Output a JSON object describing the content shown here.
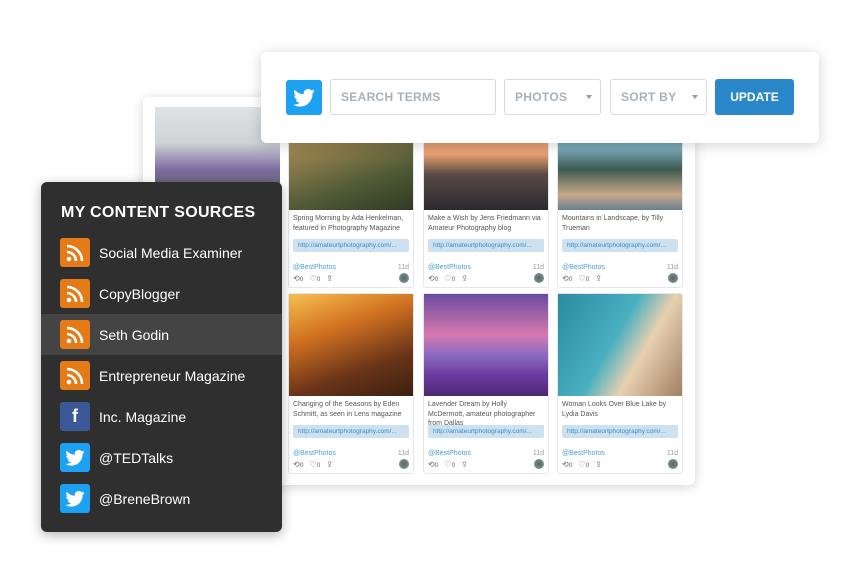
{
  "search": {
    "placeholder": "SEARCH TERMS",
    "photos": "PHOTOS",
    "sort": "SORT BY",
    "update": "UPDATE"
  },
  "sidebar": {
    "title": "MY CONTENT SOURCES",
    "items": [
      {
        "label": "Social Media Examiner",
        "icon": "rss-icon"
      },
      {
        "label": "CopyBlogger",
        "icon": "rss-icon"
      },
      {
        "label": "Seth Godin",
        "icon": "rss-icon",
        "selected": true
      },
      {
        "label": "Entrepreneur Magazine",
        "icon": "rss-icon"
      },
      {
        "label": "Inc. Magazine",
        "icon": "facebook-icon"
      },
      {
        "label": "@TEDTalks",
        "icon": "twitter-icon"
      },
      {
        "label": "@BreneBrown",
        "icon": "twitter-icon"
      }
    ]
  },
  "cards": [
    {
      "caption": "Spring Morning by Ada Henkelman, featured in Photography Magazine",
      "link": "http://amateurtphotography.com/...",
      "handle": "@BestPhotos",
      "age": "11d",
      "retweets": "0",
      "likes": "0"
    },
    {
      "caption": "Make a Wish by Jens Friedmann via Amateur Photography blog",
      "link": "http://amateurtphotography.com/...",
      "handle": "@BestPhotos",
      "age": "11d",
      "retweets": "0",
      "likes": "0"
    },
    {
      "caption": "Mountains in Landscape, by Tilly Trueman",
      "link": "http://amateurtphotography.com/...",
      "handle": "@BestPhotos",
      "age": "11d",
      "retweets": "0",
      "likes": "0"
    },
    {
      "caption": "Changing of the Seasons by Eden Schmitt, as seen in Lens magazine",
      "link": "http://amateurtphotography.com/...",
      "handle": "@BestPhotos",
      "age": "11d",
      "retweets": "0",
      "likes": "0"
    },
    {
      "caption": "Lavender Dream by Holly McDermott, amateur photographer from Dallas",
      "link": "http://amateurtphotography.com/...",
      "handle": "@BestPhotos",
      "age": "11d",
      "retweets": "0",
      "likes": "0"
    },
    {
      "caption": "Woman Looks Over Blue Lake by Lydia Davis",
      "link": "http://amateurtphotography.com/...",
      "handle": "@BestPhotos",
      "age": "11d",
      "retweets": "0",
      "likes": "0"
    }
  ]
}
